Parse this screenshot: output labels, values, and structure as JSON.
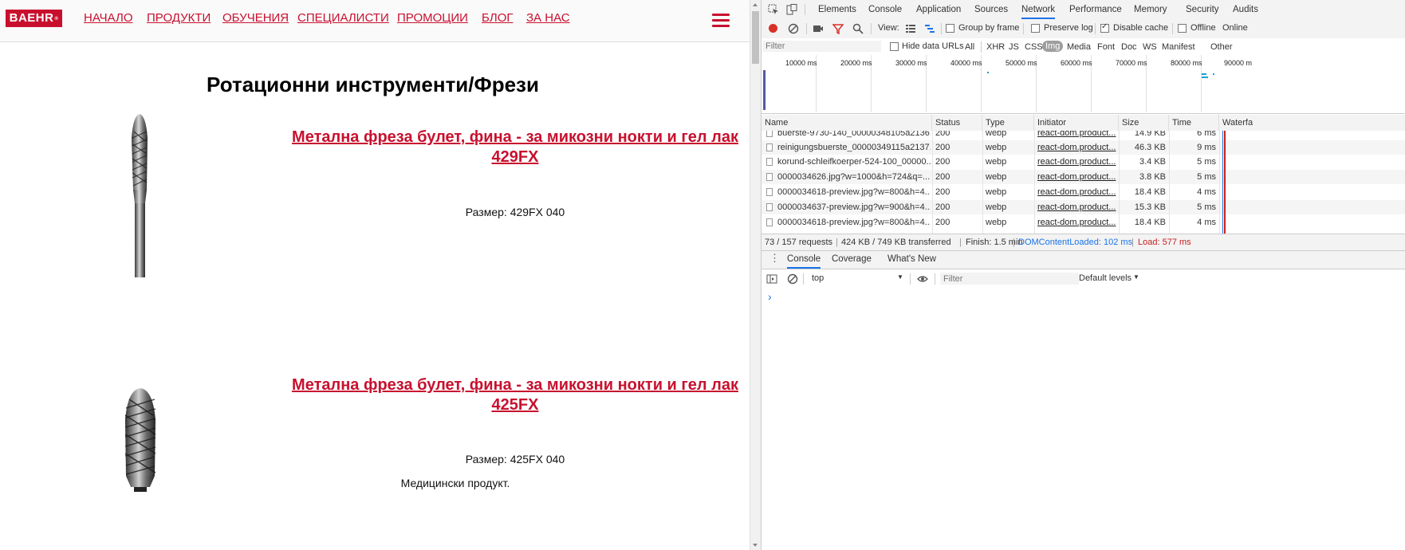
{
  "site": {
    "logo_text": "BAEHR",
    "logo_mark": "®",
    "nav": [
      "НАЧАЛО",
      "ПРОДУКТИ",
      "ОБУЧЕНИЯ",
      "СПЕЦИАЛИСТИ",
      "ПРОМОЦИИ",
      "БЛОГ",
      "ЗА НАС"
    ],
    "menu_icon": "hamburger-icon",
    "page_title": "Ротационни инструменти/Фрези",
    "products": [
      {
        "title": "Метална фреза булет, фина - за микозни нокти и гел лак 429FX",
        "size": "Размер: 429FX 040"
      },
      {
        "title": "Метална фреза булет, фина - за микозни нокти и гел лак 425FX",
        "size": "Размер: 425FX 040",
        "note": "Медицински продукт."
      }
    ],
    "colors": {
      "brand": "#c8102e"
    }
  },
  "devtools": {
    "tabs": [
      "Elements",
      "Console",
      "Application",
      "Sources",
      "Network",
      "Performance",
      "Memory",
      "Security",
      "Audits"
    ],
    "active_tab": "Network",
    "toolbar": {
      "view_label": "View:",
      "group_by_frame": "Group by frame",
      "preserve_log": "Preserve log",
      "disable_cache": "Disable cache",
      "offline": "Offline",
      "online": "Online"
    },
    "filter_bar": {
      "placeholder": "Filter",
      "hide_data_urls": "Hide data URLs",
      "types": [
        "All",
        "XHR",
        "JS",
        "CSS",
        "Img",
        "Media",
        "Font",
        "Doc",
        "WS",
        "Manifest",
        "Other"
      ],
      "active_type": "Img"
    },
    "timeline_ticks": [
      "10000 ms",
      "20000 ms",
      "30000 ms",
      "40000 ms",
      "50000 ms",
      "60000 ms",
      "70000 ms",
      "80000 ms",
      "90000 m"
    ],
    "columns": [
      "Name",
      "Status",
      "Type",
      "Initiator",
      "Size",
      "Time",
      "Waterfa"
    ],
    "rows": [
      {
        "name": "buerste-9730-140_00000348105a2136...",
        "status": "200",
        "type": "webp",
        "initiator": "react-dom.product...",
        "size": "14.9 KB",
        "time": "6 ms"
      },
      {
        "name": "reinigungsbuerste_00000349115a2137...",
        "status": "200",
        "type": "webp",
        "initiator": "react-dom.product...",
        "size": "46.3 KB",
        "time": "9 ms"
      },
      {
        "name": "korund-schleifkoerper-524-100_00000...",
        "status": "200",
        "type": "webp",
        "initiator": "react-dom.product...",
        "size": "3.4 KB",
        "time": "5 ms"
      },
      {
        "name": "0000034626.jpg?w=1000&h=724&q=...",
        "status": "200",
        "type": "webp",
        "initiator": "react-dom.product...",
        "size": "3.8 KB",
        "time": "5 ms"
      },
      {
        "name": "0000034618-preview.jpg?w=800&h=4...",
        "status": "200",
        "type": "webp",
        "initiator": "react-dom.product...",
        "size": "18.4 KB",
        "time": "4 ms"
      },
      {
        "name": "0000034637-preview.jpg?w=900&h=4...",
        "status": "200",
        "type": "webp",
        "initiator": "react-dom.product...",
        "size": "15.3 KB",
        "time": "5 ms"
      },
      {
        "name": "0000034618-preview.jpg?w=800&h=4...",
        "status": "200",
        "type": "webp",
        "initiator": "react-dom.product...",
        "size": "18.4 KB",
        "time": "4 ms"
      }
    ],
    "summary": {
      "requests": "73 / 157 requests",
      "transferred": "424 KB / 749 KB transferred",
      "finish": "Finish: 1.5 min",
      "dom_content_loaded": "DOMContentLoaded: 102 ms",
      "load": "Load: 577 ms"
    },
    "drawer_tabs": [
      "Console",
      "Coverage",
      "What's New"
    ],
    "active_drawer_tab": "Console",
    "console": {
      "context": "top",
      "filter_placeholder": "Filter",
      "levels": "Default levels",
      "prompt": "›"
    },
    "colors": {
      "dcl": "#1a73e8",
      "load": "#c5221f",
      "record": "#d93025"
    }
  }
}
